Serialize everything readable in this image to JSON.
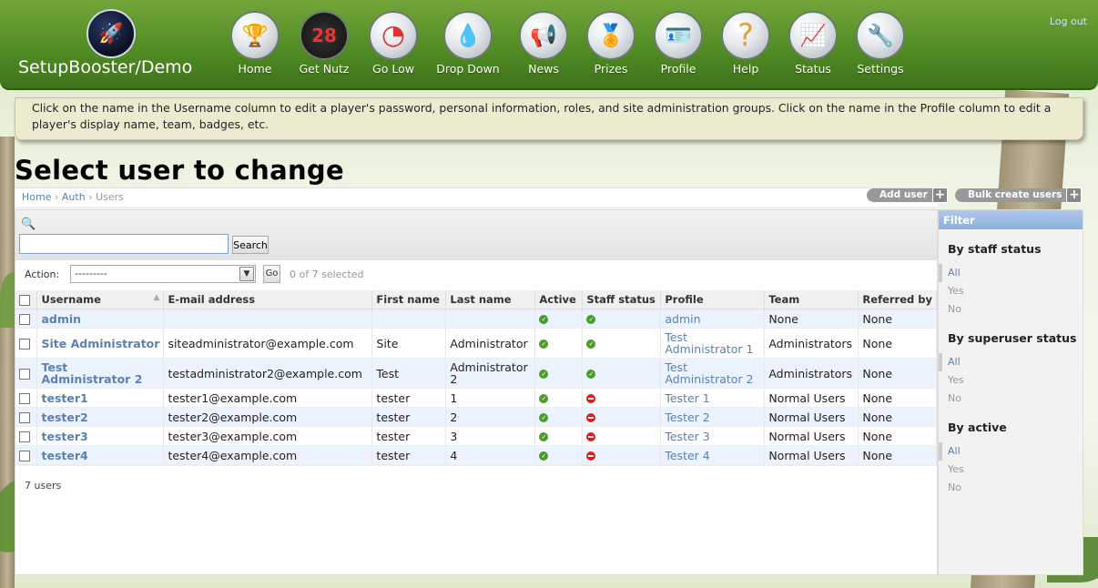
{
  "header": {
    "site_title": "SetupBooster/Demo",
    "logout": "Log out",
    "nav": [
      {
        "label": "Home",
        "icon": "trophy-icon",
        "glyph": "🏆"
      },
      {
        "label": "Get Nutz",
        "icon": "scoreboard-icon",
        "glyph": "28"
      },
      {
        "label": "Go Low",
        "icon": "gauge-icon",
        "glyph": "◔"
      },
      {
        "label": "Drop Down",
        "icon": "water-drop-icon",
        "glyph": "💧"
      },
      {
        "label": "News",
        "icon": "megaphone-icon",
        "glyph": "📢"
      },
      {
        "label": "Prizes",
        "icon": "prize-ribbon-icon",
        "glyph": "🏅"
      },
      {
        "label": "Profile",
        "icon": "profile-card-icon",
        "glyph": "🪪"
      },
      {
        "label": "Help",
        "icon": "question-mark-icon",
        "glyph": "?"
      },
      {
        "label": "Status",
        "icon": "line-chart-icon",
        "glyph": "📈"
      },
      {
        "label": "Settings",
        "icon": "wrench-icon",
        "glyph": "🔧"
      }
    ]
  },
  "help_text": "Click on the name in the Username column to edit a player's password, personal information, roles, and site administration groups. Click on the name in the Profile column to edit a player's display name, team, badges, etc.",
  "page_title": "Select user to change",
  "breadcrumb": {
    "home": "Home",
    "auth": "Auth",
    "current": "Users",
    "sep": "›"
  },
  "object_tools": {
    "add_user": "Add user",
    "bulk_create": "Bulk create users",
    "plus": "+"
  },
  "search": {
    "value": "",
    "button": "Search"
  },
  "actions": {
    "label": "Action:",
    "selected_option": "---------",
    "go": "Go",
    "selected_count": "0 of 7 selected"
  },
  "table": {
    "columns": [
      "Username",
      "E-mail address",
      "First name",
      "Last name",
      "Active",
      "Staff status",
      "Profile",
      "Team",
      "Referred by"
    ],
    "rows": [
      {
        "username": "admin",
        "email": "",
        "first": "",
        "last": "",
        "active": true,
        "staff": true,
        "profile": "admin",
        "team": "None",
        "referred": "None"
      },
      {
        "username": "Site Administrator",
        "email": "siteadministrator@example.com",
        "first": "Site",
        "last": "Administrator",
        "active": true,
        "staff": true,
        "profile": "Test Administrator 1",
        "team": "Administrators",
        "referred": "None"
      },
      {
        "username": "Test Administrator 2",
        "email": "testadministrator2@example.com",
        "first": "Test",
        "last": "Administrator 2",
        "active": true,
        "staff": true,
        "profile": "Test Administrator 2",
        "team": "Administrators",
        "referred": "None"
      },
      {
        "username": "tester1",
        "email": "tester1@example.com",
        "first": "tester",
        "last": "1",
        "active": true,
        "staff": false,
        "profile": "Tester 1",
        "team": "Normal Users",
        "referred": "None"
      },
      {
        "username": "tester2",
        "email": "tester2@example.com",
        "first": "tester",
        "last": "2",
        "active": true,
        "staff": false,
        "profile": "Tester 2",
        "team": "Normal Users",
        "referred": "None"
      },
      {
        "username": "tester3",
        "email": "tester3@example.com",
        "first": "tester",
        "last": "3",
        "active": true,
        "staff": false,
        "profile": "Tester 3",
        "team": "Normal Users",
        "referred": "None"
      },
      {
        "username": "tester4",
        "email": "tester4@example.com",
        "first": "tester",
        "last": "4",
        "active": true,
        "staff": false,
        "profile": "Tester 4",
        "team": "Normal Users",
        "referred": "None"
      }
    ]
  },
  "paginator": "7 users",
  "filter": {
    "title": "Filter",
    "groups": [
      {
        "title": "By staff status",
        "options": [
          "All",
          "Yes",
          "No"
        ]
      },
      {
        "title": "By superuser status",
        "options": [
          "All",
          "Yes",
          "No"
        ]
      },
      {
        "title": "By active",
        "options": [
          "All",
          "Yes",
          "No"
        ]
      }
    ]
  },
  "colors": {
    "header_green": "#4f8a23",
    "link": "#5b80b2",
    "filter_head": "#9dbbe4",
    "active_icon": "#4a9d2a",
    "inactive_icon": "#dd1d1d"
  }
}
